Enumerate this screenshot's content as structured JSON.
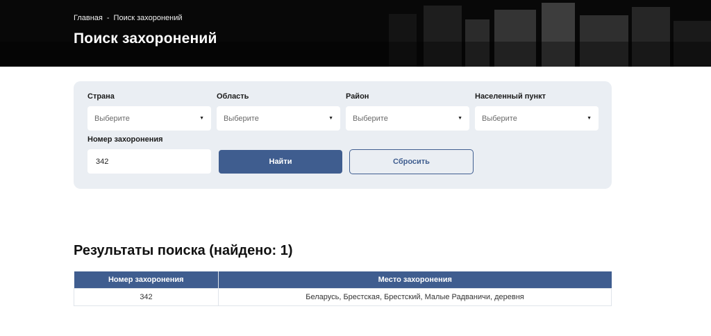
{
  "header": {
    "breadcrumb": {
      "home": "Главная",
      "separator": "-",
      "current": "Поиск захоронений"
    },
    "title": "Поиск захоронений"
  },
  "filters": {
    "country": {
      "label": "Страна",
      "value": "Выберите"
    },
    "region": {
      "label": "Область",
      "value": "Выберите"
    },
    "district": {
      "label": "Район",
      "value": "Выберите"
    },
    "locality": {
      "label": "Населенный пункт",
      "value": "Выберите"
    },
    "burial_number": {
      "label": "Номер захоронения",
      "value": "342"
    },
    "find_label": "Найти",
    "reset_label": "Сбросить"
  },
  "results": {
    "title": "Результаты поиска (найдено: 1)",
    "columns": [
      "Номер захоронения",
      "Место захоронения"
    ],
    "rows": [
      [
        "342",
        "Беларусь, Брестская, Брестский, Малые Радваничи, деревня"
      ]
    ]
  },
  "colors": {
    "accent": "#3f5d8f",
    "panel": "#eaeef3"
  },
  "icons": {
    "select_caret": "caret-down-icon"
  }
}
